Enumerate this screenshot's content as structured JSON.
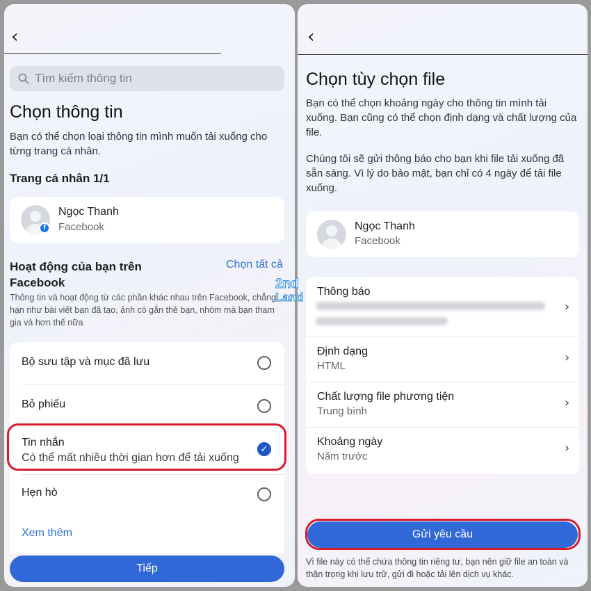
{
  "left": {
    "search_placeholder": "Tìm kiếm thông tin",
    "title": "Chọn thông tin",
    "description": "Bạn có thể chọn loại thông tin mình muốn tải xuống cho từng trang cá nhân.",
    "profile_section": "Trang cá nhân 1/1",
    "profile": {
      "name": "Ngọc Thanh",
      "platform": "Facebook"
    },
    "activity_title": "Hoạt động của bạn trên Facebook",
    "select_all": "Chọn tất cả",
    "activity_description": "Thông tin và hoạt động từ các phần khác nhau trên Facebook, chẳng hạn như bài viết bạn đã tạo, ảnh có gắn thẻ bạn, nhóm mà bạn tham gia và hơn thế nữa",
    "options": [
      {
        "label": "Bộ sưu tập và mục đã lưu",
        "checked": false
      },
      {
        "label": "Bỏ phiếu",
        "checked": false
      },
      {
        "label": "Tin nhắn",
        "sublabel": "Có thể mất nhiều thời gian hơn để tải xuống",
        "checked": true
      },
      {
        "label": "Hẹn hò",
        "checked": false
      }
    ],
    "see_more": "Xem thêm",
    "next_button": "Tiếp"
  },
  "right": {
    "title": "Chọn tùy chọn file",
    "description1": "Bạn có thể chọn khoảng ngày cho thông tin mình tải xuống. Bạn cũng có thể chọn định dạng và chất lượng của file.",
    "description2": "Chúng tôi sẽ gửi thông báo cho bạn khi file tải xuống đã sẵn sàng. Vì lý do bảo mật, bạn chỉ có 4 ngày để tải file xuống.",
    "profile": {
      "name": "Ngọc Thanh",
      "platform": "Facebook"
    },
    "settings": [
      {
        "label": "Thông báo",
        "value": ""
      },
      {
        "label": "Định dạng",
        "value": "HTML"
      },
      {
        "label": "Chất lượng file phương tiện",
        "value": "Trung bình"
      },
      {
        "label": "Khoảng ngày",
        "value": "Năm trước"
      }
    ],
    "submit_button": "Gửi yêu cầu",
    "footer_note": "Vì file này có thể chứa thông tin riêng tư, bạn nên giữ file an toàn và thận trọng khi lưu trữ, gửi đi hoặc tải lên dịch vụ khác."
  },
  "watermark": {
    "top": "2nd",
    "bottom": "Land"
  },
  "colors": {
    "accent": "#3068d8",
    "highlight": "#d81b2a",
    "link": "#2f6fd6"
  }
}
